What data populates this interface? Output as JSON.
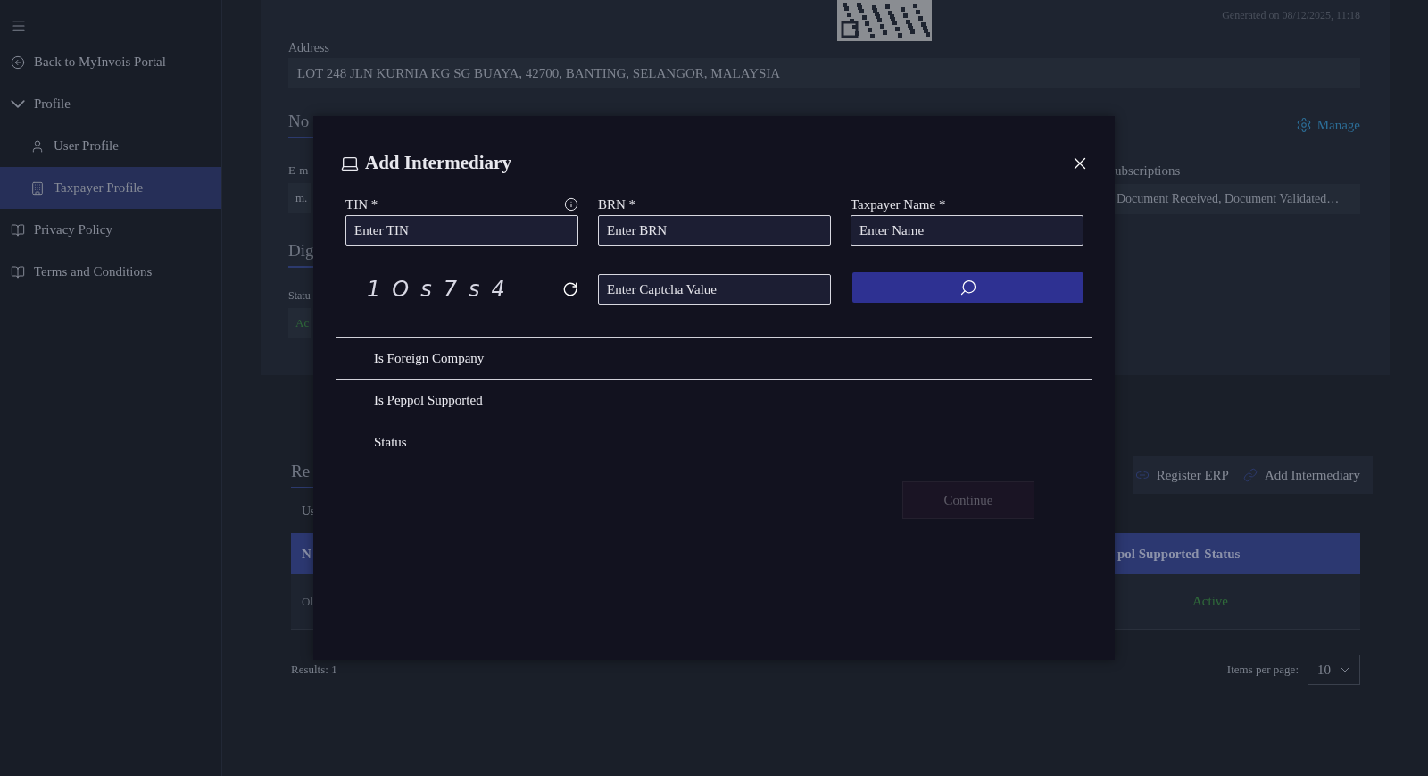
{
  "sidebar": {
    "items": [
      {
        "kind": "back",
        "label": "Back to MyInvois Portal",
        "selected": false
      },
      {
        "kind": "group",
        "label": "Profile",
        "expanded": true,
        "children": [
          {
            "kind": "user",
            "label": "User Profile",
            "selected": false
          },
          {
            "kind": "building",
            "label": "Taxpayer Profile",
            "selected": true
          }
        ]
      },
      {
        "kind": "book",
        "label": "Privacy Policy",
        "selected": false
      },
      {
        "kind": "book",
        "label": "Terms and Conditions",
        "selected": false
      }
    ]
  },
  "profile": {
    "generated": "Generated on 08/12/2025, 11:18",
    "address_label": "Address",
    "address": "LOT 248 JLN KURNIA KG SG BUAYA, 42700, BANTING, SELANGOR, MALAYSIA",
    "notifications_heading": "No",
    "manage": "Manage",
    "email_label": "E-m",
    "email_value": "m.",
    "subscriptions_label": "ubscriptions",
    "subscriptions_value": "Document Received, Document Validated…",
    "digital_heading": "Dig",
    "status_label": "Statu",
    "status_value": "Ac"
  },
  "related": {
    "heading": "Re",
    "toolbar": [
      "Register ERP",
      "Add Intermediary"
    ],
    "tab": "Us",
    "table": {
      "columns": [
        "N",
        "pol Supported",
        "Status"
      ],
      "rows": [
        [
          "Ol",
          "Active"
        ]
      ]
    },
    "results": "Results: 1",
    "items_per_page_label": "Items per page:",
    "items_per_page": "10"
  },
  "modal": {
    "title": "Add Intermediary",
    "fields": [
      {
        "label": "TIN *",
        "placeholder": "Enter TIN",
        "info": true
      },
      {
        "label": "BRN *",
        "placeholder": "Enter BRN",
        "info": false
      },
      {
        "label": "Taxpayer Name *",
        "placeholder": "Enter Name",
        "info": false
      }
    ],
    "captcha": "1Os7s4",
    "captcha_placeholder": "Enter Captcha Value",
    "details": [
      "Is Foreign Company",
      "Is Peppol Supported",
      "Status"
    ],
    "continue": {
      "label": "Continue",
      "disabled": true
    }
  }
}
